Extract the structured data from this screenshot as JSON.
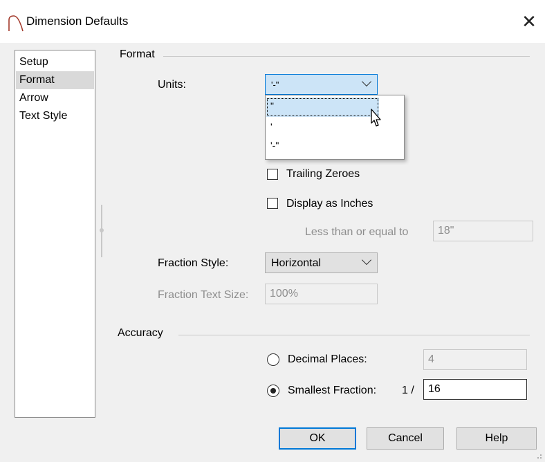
{
  "window": {
    "title": "Dimension Defaults",
    "close_glyph": "✕"
  },
  "sidebar": {
    "items": [
      {
        "label": "Setup",
        "selected": false
      },
      {
        "label": "Format",
        "selected": true
      },
      {
        "label": "Arrow",
        "selected": false
      },
      {
        "label": "Text Style",
        "selected": false
      }
    ]
  },
  "format": {
    "group_label": "Format",
    "units_label": "Units:",
    "units_value": "'-\"",
    "units_options": [
      "\"",
      "'",
      "'-\""
    ],
    "units_highlighted_index": 0,
    "trailing_zeroes_label": "Trailing Zeroes",
    "trailing_zeroes_checked": false,
    "display_inches_label": "Display as Inches",
    "display_inches_checked": false,
    "less_than_label": "Less than or equal to",
    "less_than_value": "18\"",
    "fraction_style_label": "Fraction Style:",
    "fraction_style_value": "Horizontal",
    "fraction_text_size_label": "Fraction Text Size:",
    "fraction_text_size_value": "100%"
  },
  "accuracy": {
    "group_label": "Accuracy",
    "decimal_places_label": "Decimal Places:",
    "decimal_places_value": "4",
    "decimal_selected": false,
    "smallest_fraction_label": "Smallest Fraction:",
    "smallest_fraction_prefix": "1 /",
    "smallest_fraction_value": "16",
    "fraction_selected": true
  },
  "buttons": {
    "ok": "OK",
    "cancel": "Cancel",
    "help": "Help"
  },
  "colors": {
    "accent": "#0078d7",
    "highlight": "#cce4f7",
    "icon": "#a33a2c"
  }
}
